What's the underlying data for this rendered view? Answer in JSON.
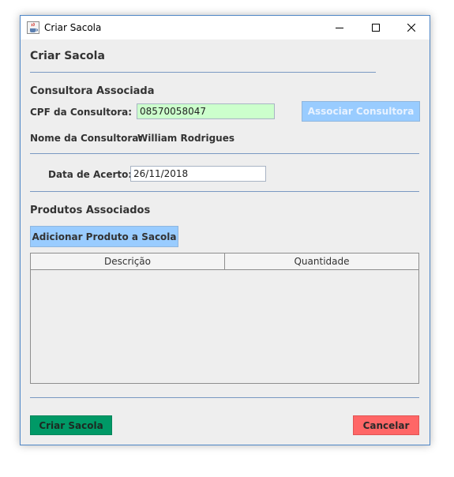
{
  "window": {
    "title": "Criar Sacola",
    "controls": {
      "minimize": "minimize",
      "maximize": "maximize",
      "close": "close"
    }
  },
  "form": {
    "heading": "Criar Sacola",
    "consultora": {
      "section_title": "Consultora Associada",
      "cpf_label": "CPF da Consultora:",
      "cpf_value": "08570058047",
      "associate_button": "Associar Consultora",
      "name_label": "Nome da Consultora:",
      "name_value": "William Rodrigues"
    },
    "acerto": {
      "date_label": "Data de Acerto:",
      "date_value": "26/11/2018"
    },
    "produtos": {
      "section_title": "Produtos Associados",
      "add_button": "Adicionar Produto a Sacola",
      "table": {
        "columns": [
          "Descrição",
          "Quantidade"
        ],
        "rows": []
      }
    },
    "footer": {
      "create_button": "Criar Sacola",
      "cancel_button": "Cancelar"
    }
  },
  "colors": {
    "cpf_field_bg": "#ccffcc",
    "associate_button_bg": "#99ccff",
    "associate_button_text": "#e8f2ff",
    "add_button_bg": "#99ccff",
    "create_button_bg": "#009966",
    "cancel_button_bg": "#ff6666",
    "separator": "#7a99c2"
  }
}
